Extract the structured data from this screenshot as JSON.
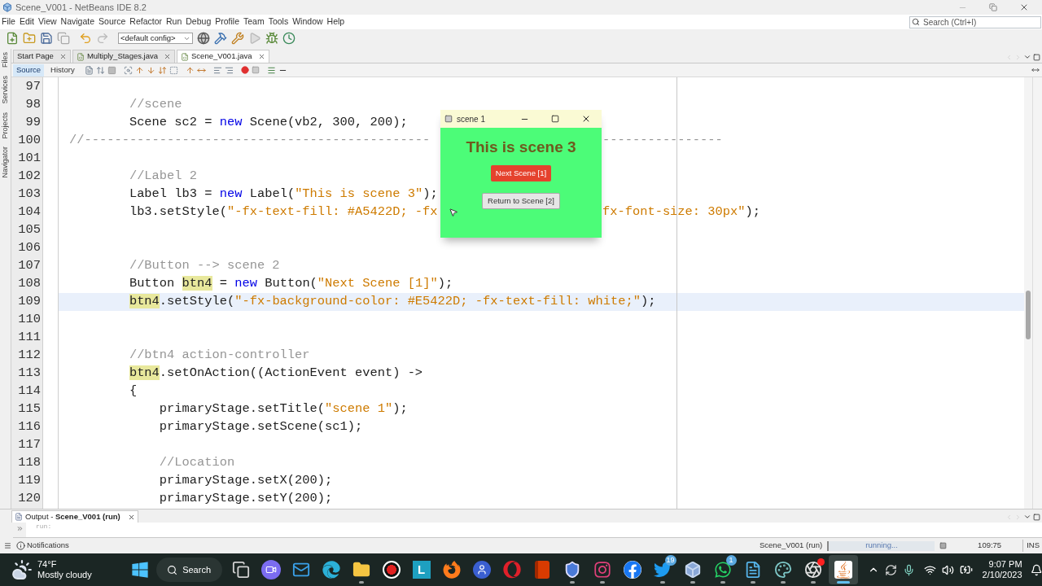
{
  "window": {
    "title": "Scene_V001 - NetBeans IDE 8.2"
  },
  "menu": [
    "File",
    "Edit",
    "View",
    "Navigate",
    "Source",
    "Refactor",
    "Run",
    "Debug",
    "Profile",
    "Team",
    "Tools",
    "Window",
    "Help"
  ],
  "search": {
    "placeholder": "Search (Ctrl+I)"
  },
  "config": {
    "value": "<default config>"
  },
  "editor_tabs": [
    {
      "label": "Start Page",
      "selected": false,
      "kind": "page"
    },
    {
      "label": "Multiply_Stages.java",
      "selected": false,
      "kind": "java"
    },
    {
      "label": "Scene_V001.java",
      "selected": true,
      "kind": "java"
    }
  ],
  "side_tabs": [
    "Files",
    "Services",
    "Projects",
    "Navigator"
  ],
  "view_tabs": [
    {
      "label": "Source",
      "selected": true
    },
    {
      "label": "History",
      "selected": false
    }
  ],
  "code_lines": [
    {
      "number": "97",
      "current": false
    },
    {
      "number": "98",
      "current": false,
      "parts": [
        [
          {
            "kind": "comment",
            "text": "        //scene"
          }
        ]
      ]
    },
    {
      "number": "99",
      "current": false,
      "parts": [
        [
          {
            "kind": "plain",
            "text": "        Scene sc2 = "
          },
          {
            "kind": "keyword",
            "text": "new"
          },
          {
            "kind": "plain",
            "text": " Scene(vb2, 300, 200);"
          }
        ]
      ]
    },
    {
      "number": "100",
      "current": false,
      "parts": [
        [
          {
            "kind": "comment",
            "text": "//----------------------------------------------"
          }
        ],
        [
          {
            "kind": "comment",
            "text": "----------------"
          }
        ]
      ]
    },
    {
      "number": "101",
      "current": false
    },
    {
      "number": "102",
      "current": false,
      "parts": [
        [
          {
            "kind": "comment",
            "text": "        //Label 2"
          }
        ]
      ]
    },
    {
      "number": "103",
      "current": false,
      "parts": [
        [
          {
            "kind": "plain",
            "text": "        Label lb3 = "
          },
          {
            "kind": "keyword",
            "text": "new"
          },
          {
            "kind": "plain",
            "text": " Label("
          },
          {
            "kind": "string",
            "text": "\"This is scene 3\""
          },
          {
            "kind": "plain",
            "text": ");"
          }
        ]
      ]
    },
    {
      "number": "104",
      "current": false,
      "parts": [
        [
          {
            "kind": "plain",
            "text": "        lb3.setStyle("
          },
          {
            "kind": "string",
            "text": "\"-fx-text-fill: #A5422D; -fx"
          }
        ],
        [
          {
            "kind": "string",
            "text": "fx-font-size: 30px\""
          },
          {
            "kind": "plain",
            "text": ");"
          }
        ]
      ]
    },
    {
      "number": "105",
      "current": false
    },
    {
      "number": "106",
      "current": false
    },
    {
      "number": "107",
      "current": false,
      "parts": [
        [
          {
            "kind": "comment",
            "text": "        //Button --> scene 2"
          }
        ]
      ]
    },
    {
      "number": "108",
      "current": false,
      "parts": [
        [
          {
            "kind": "plain",
            "text": "        Button "
          },
          {
            "kind": "mark",
            "text": "btn4"
          },
          {
            "kind": "plain",
            "text": " = "
          },
          {
            "kind": "keyword",
            "text": "new"
          },
          {
            "kind": "plain",
            "text": " Button("
          },
          {
            "kind": "string",
            "text": "\"Next Scene [1]\""
          },
          {
            "kind": "plain",
            "text": ");"
          }
        ]
      ]
    },
    {
      "number": "109",
      "current": true,
      "parts": [
        [
          {
            "kind": "mark",
            "text": "        btn4"
          },
          {
            "kind": "plain",
            "text": ".setStyle("
          },
          {
            "kind": "string",
            "text": "\"-fx-background-color: #E5422D; -fx-text-fill: white;\""
          },
          {
            "kind": "plain",
            "text": ");"
          }
        ]
      ]
    },
    {
      "number": "110",
      "current": false
    },
    {
      "number": "111",
      "current": false
    },
    {
      "number": "112",
      "current": false,
      "parts": [
        [
          {
            "kind": "comment",
            "text": "        //btn4 action-controller"
          }
        ]
      ]
    },
    {
      "number": "113",
      "current": false,
      "parts": [
        [
          {
            "kind": "mark",
            "text": "        btn4"
          },
          {
            "kind": "plain",
            "text": ".setOnAction((ActionEvent event) ->"
          }
        ]
      ]
    },
    {
      "number": "114",
      "current": false,
      "parts": [
        [
          {
            "kind": "plain",
            "text": "        {"
          }
        ]
      ]
    },
    {
      "number": "115",
      "current": false,
      "parts": [
        [
          {
            "kind": "plain",
            "text": "            primaryStage.setTitle("
          },
          {
            "kind": "string",
            "text": "\"scene 1\""
          },
          {
            "kind": "plain",
            "text": ");"
          }
        ]
      ]
    },
    {
      "number": "116",
      "current": false,
      "parts": [
        [
          {
            "kind": "plain",
            "text": "            primaryStage.setScene(sc1);"
          }
        ]
      ]
    },
    {
      "number": "117",
      "current": false
    },
    {
      "number": "118",
      "current": false,
      "parts": [
        [
          {
            "kind": "comment",
            "text": "            //Location"
          }
        ]
      ]
    },
    {
      "number": "119",
      "current": false,
      "parts": [
        [
          {
            "kind": "plain",
            "text": "            primaryStage.setX(200);"
          }
        ]
      ]
    },
    {
      "number": "120",
      "current": false,
      "parts": [
        [
          {
            "kind": "plain",
            "text": "            primaryStage.setY(200);"
          }
        ]
      ]
    }
  ],
  "dialog": {
    "title": "scene 1",
    "heading": "This is scene 3",
    "buttons": [
      {
        "label": "Next Scene [1]",
        "kind": "primary"
      },
      {
        "label": "Return to Scene [2]",
        "kind": "default"
      }
    ]
  },
  "output": {
    "tab_label": "Output - **Scene_V001 (run)**",
    "lines": [
      "run:"
    ]
  },
  "status_bar": {
    "notifications": "Notifications",
    "task": "Scene_V001 (run)",
    "progress": "running...",
    "level": 1,
    "position": "109:75",
    "mode": "INS"
  },
  "taskbar": {
    "weather": {
      "temperature": "74°F",
      "condition": "Mostly cloudy"
    },
    "search": "Search",
    "apps": [
      {
        "kind": "taskview",
        "running": false,
        "selected": false
      },
      {
        "kind": "videocall",
        "running": false,
        "selected": false
      },
      {
        "kind": "mail",
        "running": false,
        "selected": false
      },
      {
        "kind": "edge",
        "running": false,
        "selected": false
      },
      {
        "kind": "folder",
        "running": true,
        "selected": false
      },
      {
        "kind": "record",
        "running": false,
        "selected": false
      },
      {
        "kind": "letter",
        "text": "L",
        "running": false,
        "selected": false
      },
      {
        "kind": "firefox",
        "running": false,
        "selected": false
      },
      {
        "kind": "person",
        "running": false,
        "selected": false
      },
      {
        "kind": "opera",
        "running": false,
        "selected": false
      },
      {
        "kind": "office",
        "running": false,
        "selected": false
      },
      {
        "kind": "shield",
        "running": true,
        "selected": false
      },
      {
        "kind": "instagram",
        "running": true,
        "selected": false
      },
      {
        "kind": "facebook",
        "running": false,
        "selected": false
      },
      {
        "kind": "twitter",
        "badge": "19",
        "running": true,
        "selected": false
      },
      {
        "kind": "cube",
        "running": true,
        "selected": false
      },
      {
        "kind": "whatsapp",
        "badge": "1",
        "running": true,
        "selected": false
      },
      {
        "kind": "notepad",
        "running": true,
        "selected": false
      },
      {
        "kind": "palette",
        "running": true,
        "selected": false
      },
      {
        "kind": "obs",
        "running": true,
        "selected": false
      },
      {
        "kind": "java",
        "running": true,
        "selected": true
      }
    ],
    "clock": {
      "time": "9:07 PM",
      "date": "2/10/2023"
    }
  }
}
